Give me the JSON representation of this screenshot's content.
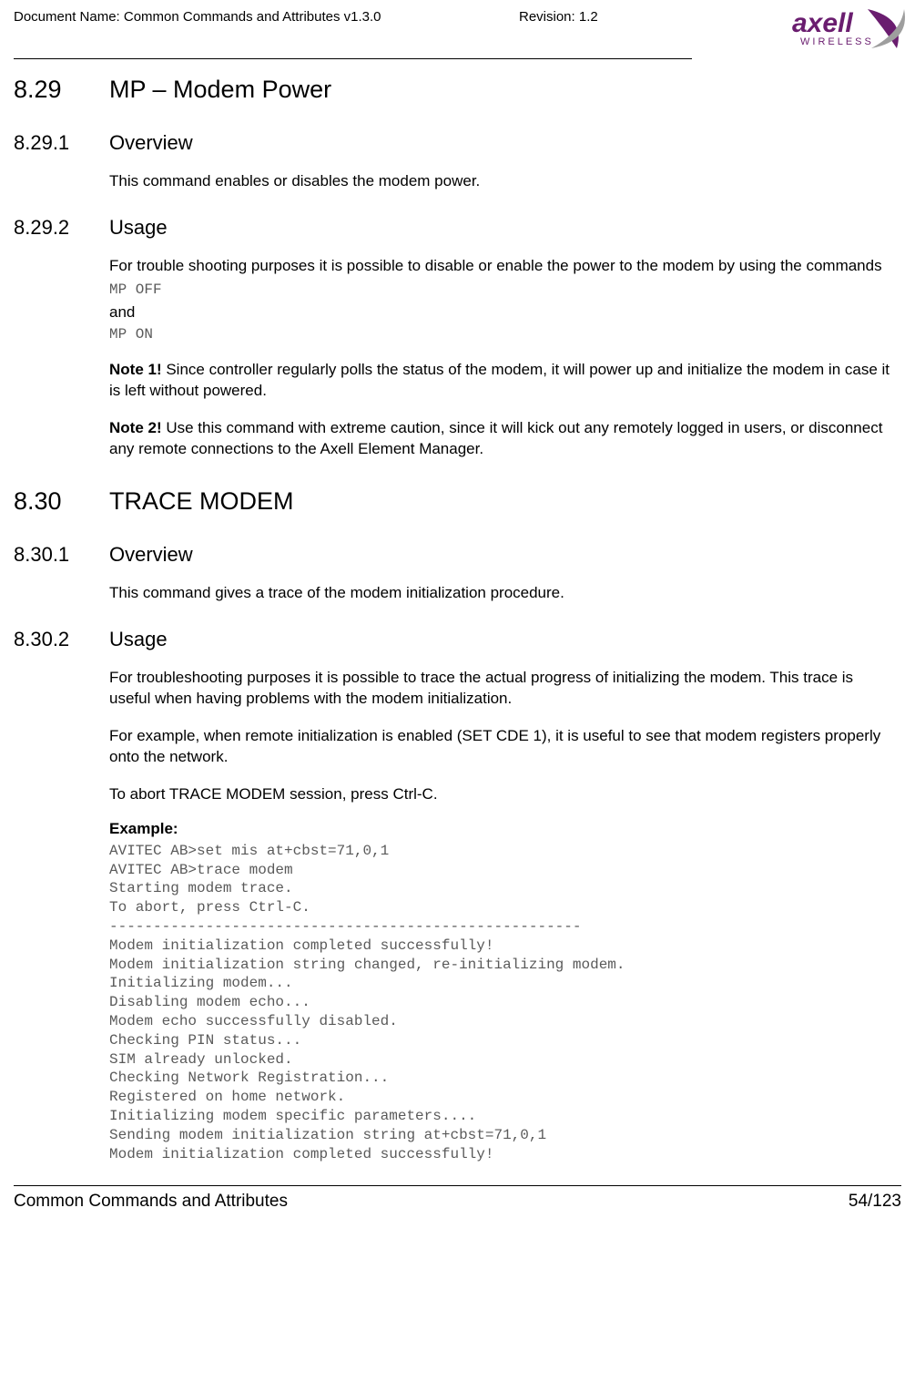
{
  "header": {
    "doc_name": "Document Name: Common Commands and Attributes v1.3.0",
    "revision": "Revision: 1.2",
    "logo_brand": "axell",
    "logo_sub": "WIRELESS"
  },
  "sec_829": {
    "num": "8.29",
    "title": "MP – Modem Power",
    "overview_num": "8.29.1",
    "overview_title": "Overview",
    "overview_body": "This command enables or disables the modem power.",
    "usage_num": "8.29.2",
    "usage_title": "Usage",
    "usage_intro": "For trouble shooting purposes it is possible to disable or enable the power to the modem by using the commands",
    "cmd_off": "MP OFF",
    "and_word": "and",
    "cmd_on": "MP ON",
    "note1_label": "Note 1!",
    "note1_body": " Since controller regularly polls the status of the modem, it will power up and initialize the modem in case it is left without powered.",
    "note2_label": "Note 2!",
    "note2_body": " Use this command with extreme caution, since it will kick out any remotely logged in users, or disconnect any remote connections to the Axell Element Manager."
  },
  "sec_830": {
    "num": "8.30",
    "title": "TRACE MODEM",
    "overview_num": "8.30.1",
    "overview_title": "Overview",
    "overview_body": "This command gives a trace of the modem initialization procedure.",
    "usage_num": "8.30.2",
    "usage_title": "Usage",
    "usage_para1": "For troubleshooting purposes it is possible to trace the actual progress of initializing the modem. This trace is useful when having problems with the modem initialization.",
    "usage_para2": "For example, when remote initialization is enabled (SET CDE 1), it is useful to see that modem registers properly onto the network.",
    "usage_para3": "To abort TRACE MODEM session, press Ctrl-C.",
    "example_label": "Example:",
    "example_body": "AVITEC AB>set mis at+cbst=71,0,1\nAVITEC AB>trace modem\nStarting modem trace.\nTo abort, press Ctrl-C.\n------------------------------------------------------\nModem initialization completed successfully!\nModem initialization string changed, re-initializing modem.\nInitializing modem...\nDisabling modem echo...\nModem echo successfully disabled.\nChecking PIN status...\nSIM already unlocked.\nChecking Network Registration...\nRegistered on home network.\nInitializing modem specific parameters....\nSending modem initialization string at+cbst=71,0,1\nModem initialization completed successfully!"
  },
  "footer": {
    "left": "Common Commands and Attributes",
    "right": "54/123"
  }
}
